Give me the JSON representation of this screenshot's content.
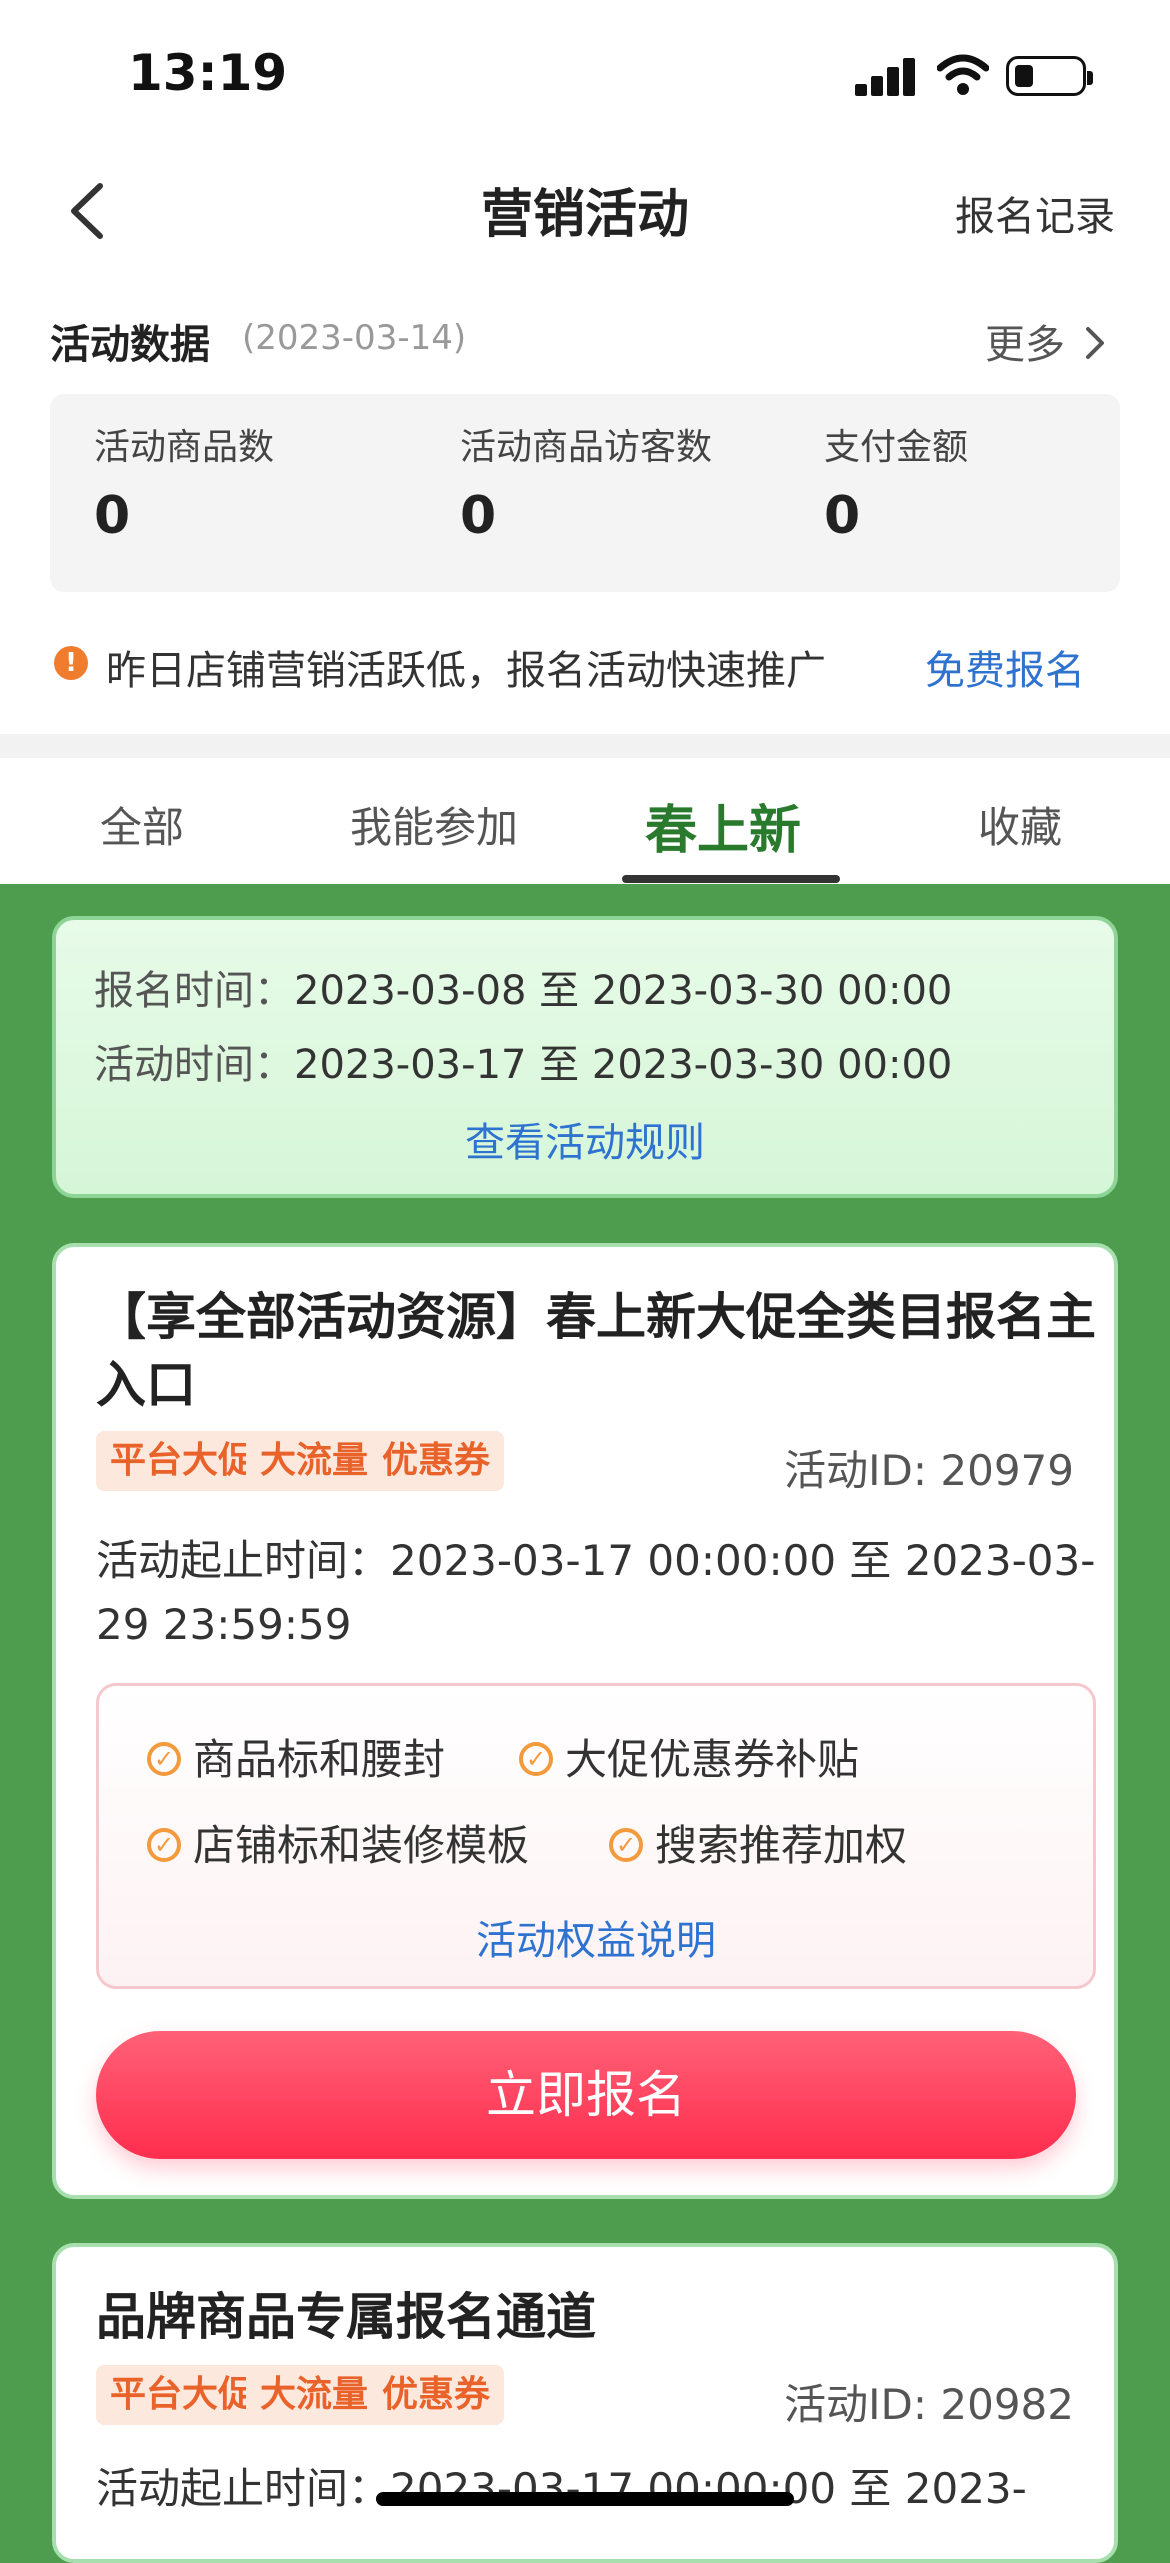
{
  "status_bar": {
    "time": "13:19"
  },
  "nav": {
    "title": "营销活动",
    "record": "报名记录"
  },
  "data_section": {
    "title": "活动数据",
    "date": "(2023-03-14)",
    "more": "更多",
    "stats": [
      {
        "label": "活动商品数",
        "value": "0"
      },
      {
        "label": "活动商品访客数",
        "value": "0"
      },
      {
        "label": "支付金额",
        "value": "0"
      }
    ],
    "notice": "昨日店铺营销活跃低，报名活动快速推广",
    "notice_link": "免费报名"
  },
  "tabs": [
    {
      "label": "全部"
    },
    {
      "label": "我能参加"
    },
    {
      "label": "春上新",
      "active": true
    },
    {
      "label": "收藏"
    }
  ],
  "time_info": {
    "signup_label": "报名时间：",
    "signup_value": "2023-03-08 至 2023-03-30 00:00",
    "activity_label": "活动时间：",
    "activity_value": "2023-03-17 至 2023-03-30 00:00",
    "rules_link": "查看活动规则"
  },
  "activities": [
    {
      "title": "【享全部活动资源】春上新大促全类目报名主入口",
      "tags": [
        "平台大促",
        "大流量",
        "优惠券"
      ],
      "id_text": "活动ID: 20979",
      "period": "活动起止时间：2023-03-17 00:00:00 至 2023-03-29 23:59:59",
      "benefits": [
        "商品标和腰封",
        "大促优惠券补贴",
        "店铺标和装修模板",
        "搜索推荐加权"
      ],
      "benefit_link": "活动权益说明",
      "button": "立即报名"
    },
    {
      "title": "品牌商品专属报名通道",
      "tags": [
        "平台大促",
        "大流量",
        "优惠券"
      ],
      "id_text": "活动ID: 20982",
      "period": "活动起止时间：2023-03-17 00:00:00 至 2023-"
    }
  ],
  "colors": {
    "brand_green": "#4e9d4f",
    "active_tab": "#2a7a2d",
    "link_blue": "#2f73d0",
    "tag_orange": "#e8622a",
    "button_red": "#ff3d5c"
  }
}
